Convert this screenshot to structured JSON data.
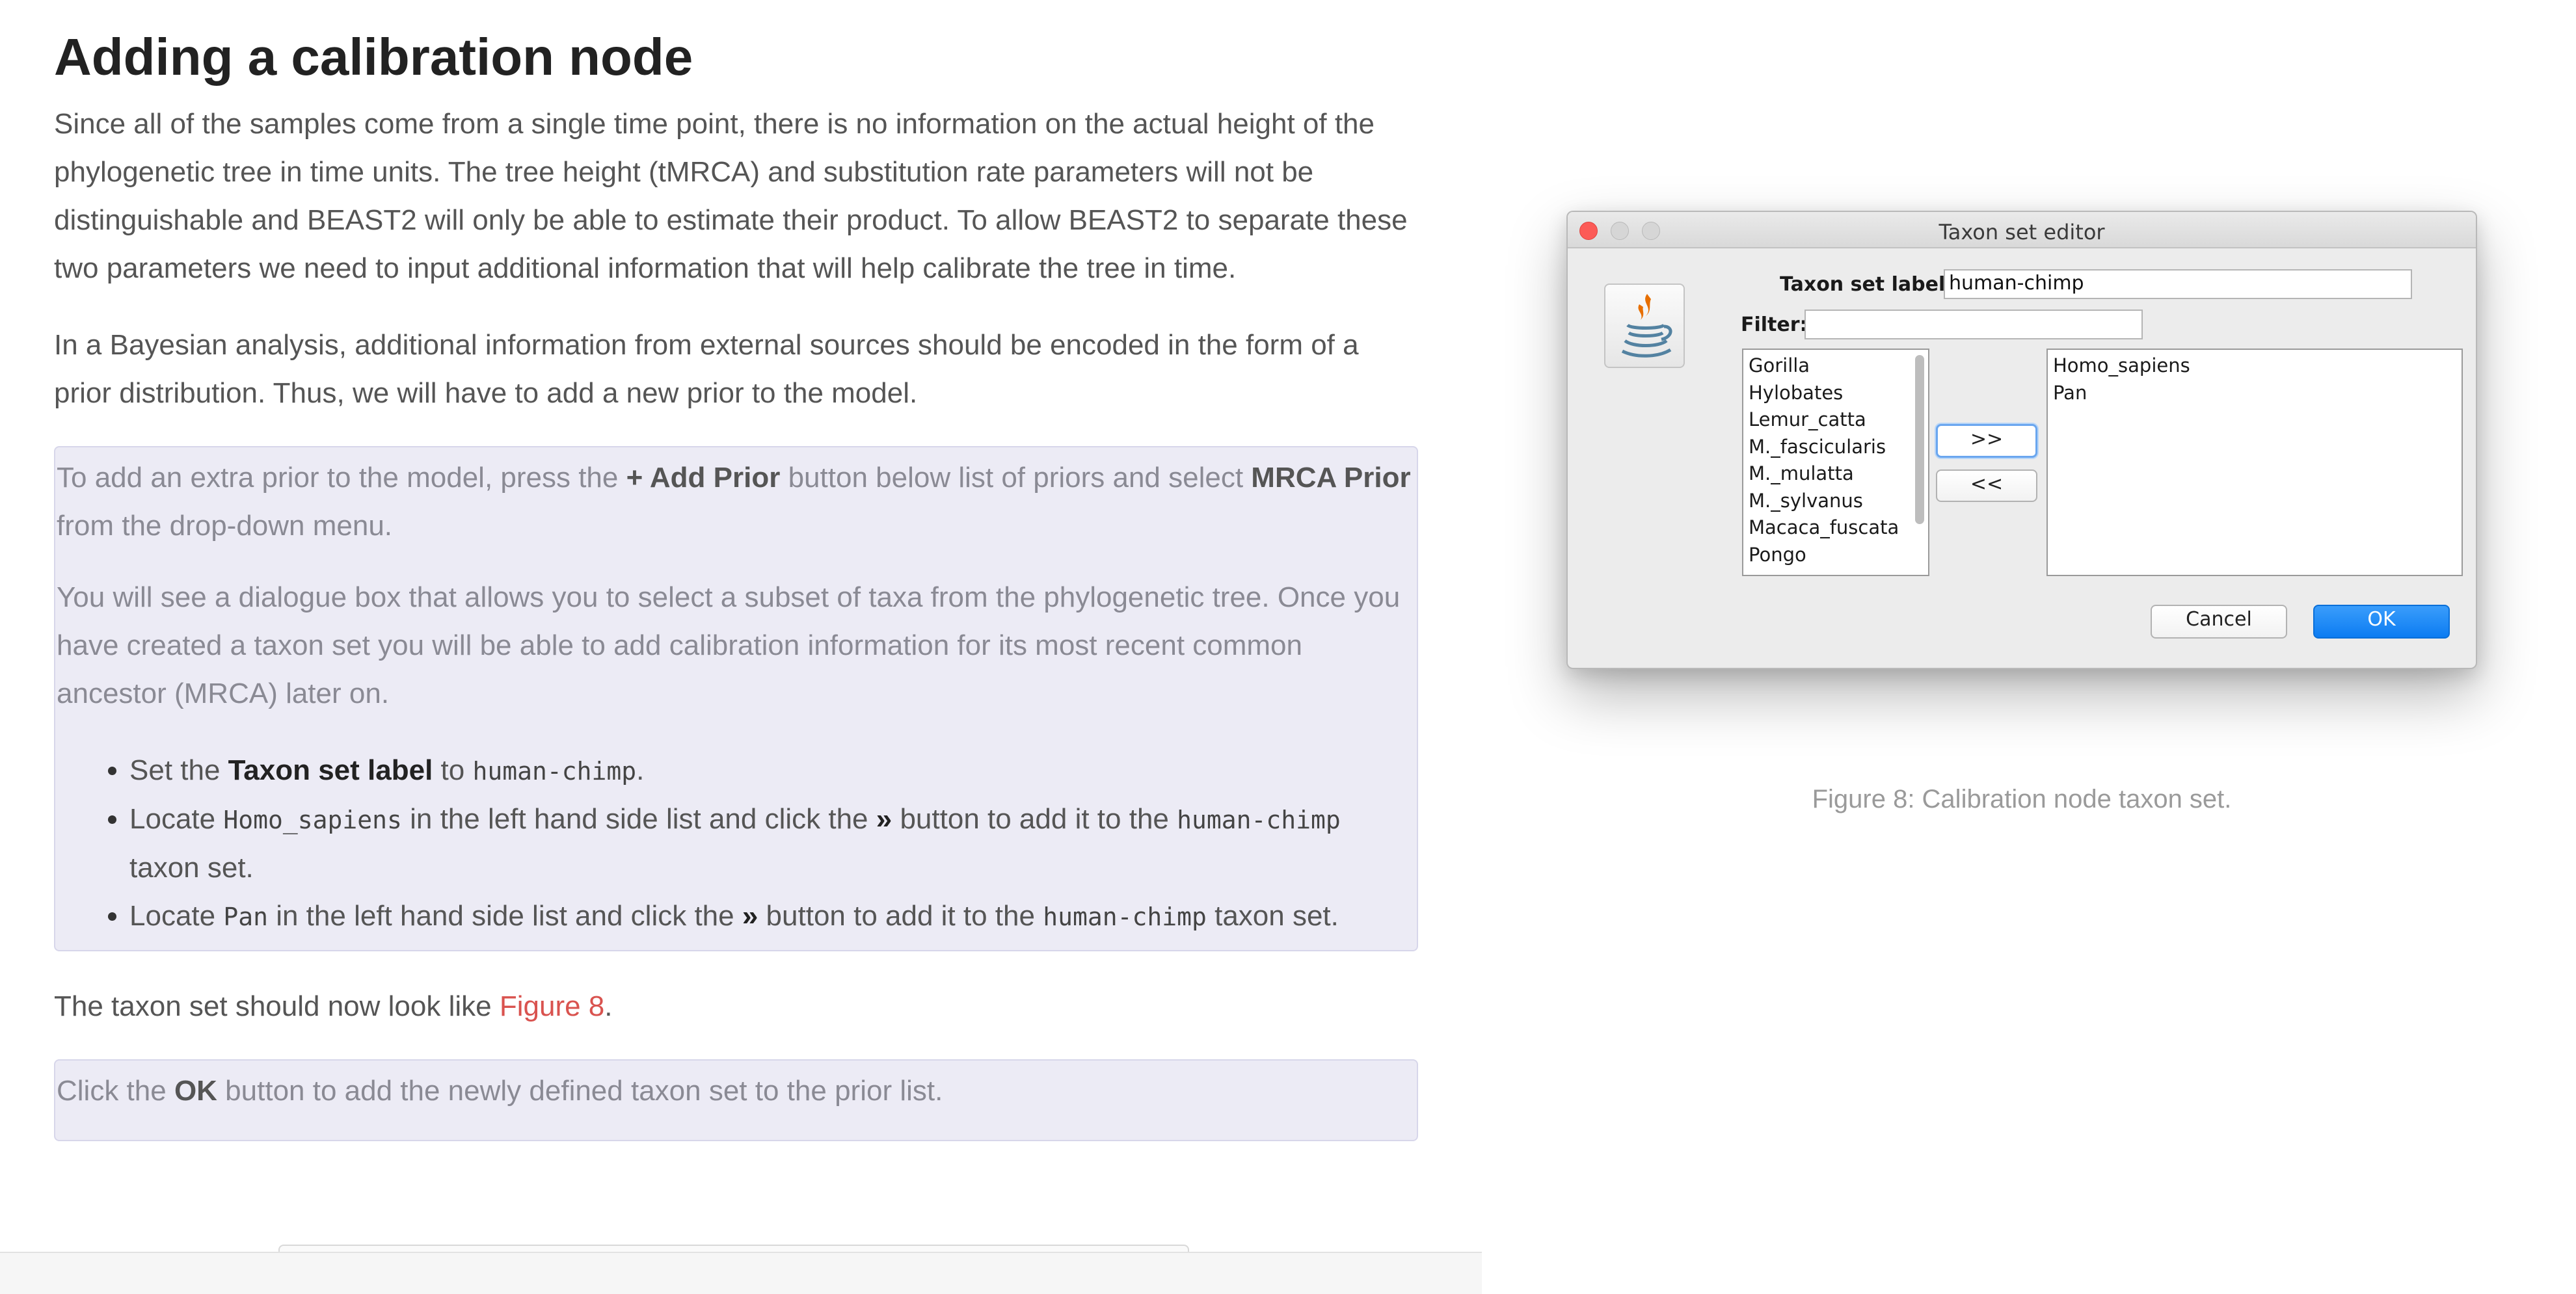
{
  "article": {
    "heading": "Adding a calibration node",
    "intro_p1": "Since all of the samples come from a single time point, there is no information on the actual height of the phylogenetic tree in time units. The tree height (tMRCA) and substitution rate parameters will not be distinguishable and BEAST2 will only be able to estimate their product. To allow BEAST2 to separate these two parameters we need to input additional information that will help calibrate the tree in time.",
    "intro_p2": "In a Bayesian analysis, additional information from external sources should be encoded in the form of a prior distribution. Thus, we will have to add a new prior to the model.",
    "callout1": {
      "p1_before": "To add an extra prior to the model, press the ",
      "p1_bold1": "+ Add Prior",
      "p1_middle": " button below list of priors and select ",
      "p1_bold2": "MRCA Prior",
      "p1_after": " from the drop-down menu.",
      "p2": "You will see a dialogue box that allows you to select a subset of taxa from the phylogenetic tree. Once you have created a taxon set you will be able to add calibration information for its most recent common ancestor (MRCA) later on.",
      "bullets": [
        {
          "t1": "Set the ",
          "b1": "Taxon set label",
          "t2": " to ",
          "code1": "human-chimp",
          "t3": "."
        },
        {
          "t1": "Locate ",
          "code1": "Homo_sapiens",
          "t2": " in the left hand side list and click the ",
          "b1": "»",
          "t3": " button to add it to the ",
          "code2": "human-chimp",
          "t4": " taxon set."
        },
        {
          "t1": "Locate ",
          "code1": "Pan",
          "t2": " in the left hand side list and click the ",
          "b1": "»",
          "t3": " button to add it to the ",
          "code2": "human-chimp",
          "t4": " taxon set."
        }
      ]
    },
    "after_p_before": "The taxon set should now look like ",
    "after_p_link": "Figure 8",
    "after_p_after": ".",
    "callout2": {
      "before": "Click the ",
      "bold": "OK",
      "after": " button to add the newly defined taxon set to the prior list."
    }
  },
  "dialog": {
    "title": "Taxon set editor",
    "label_taxon_set": "Taxon set label:",
    "taxon_set_value": "human-chimp",
    "label_filter": "Filter:",
    "filter_value": "",
    "left_list": [
      "Gorilla",
      "Hylobates",
      "Lemur_catta",
      "M._fascicularis",
      "M._mulatta",
      "M._sylvanus",
      "Macaca_fuscata",
      "Pongo"
    ],
    "right_list": [
      "Homo_sapiens",
      "Pan"
    ],
    "add_button": ">>",
    "remove_button": "<<",
    "cancel_button": "Cancel",
    "ok_button": "OK",
    "icon": "java-icon",
    "accent_color": "#0c7cf2"
  },
  "figure": {
    "caption": "Figure 8: Calibration node taxon set."
  }
}
